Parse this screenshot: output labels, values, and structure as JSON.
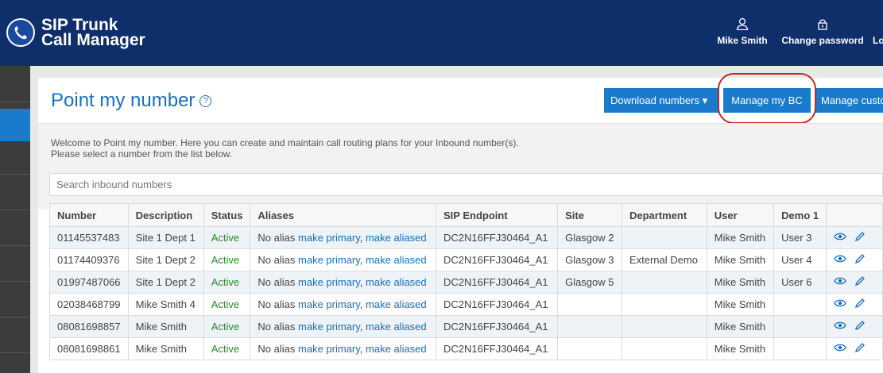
{
  "header": {
    "app_title_line1": "SIP Trunk",
    "app_title_line2": "Call Manager",
    "user_name": "Mike Smith",
    "change_password_label": "Change password",
    "logout_label_partial": "Lo",
    "user_icon": "user-icon",
    "lock_icon": "lock-icon",
    "logo_icon": "phone-icon"
  },
  "page": {
    "title": "Point my number",
    "help_icon": "help-icon",
    "welcome_line1": "Welcome to Point my number. Here you can create and maintain call routing plans for your Inbound number(s).",
    "welcome_line2": "Please select a number from the list below."
  },
  "toolbar": {
    "download_label": "Download numbers ▾",
    "manage_bc_label": "Manage my BC",
    "manage_custom_label": "Manage custo"
  },
  "search": {
    "placeholder": "Search inbound numbers"
  },
  "table": {
    "columns": [
      "Number",
      "Description",
      "Status",
      "Aliases",
      "SIP Endpoint",
      "Site",
      "Department",
      "User",
      "Demo 1",
      ""
    ],
    "rows": [
      {
        "number": "01145537483",
        "description": "Site 1 Dept 1",
        "status": "Active",
        "alias": "No alias",
        "make_primary": "make primary",
        "comma": ",",
        "make_aliased": "make aliased",
        "endpoint": "DC2N16FFJ30464_A1",
        "site": "Glasgow 2",
        "department": "",
        "user": "Mike Smith",
        "demo1": "User 3"
      },
      {
        "number": "01174409376",
        "description": "Site 1 Dept 2",
        "status": "Active",
        "alias": "No alias",
        "make_primary": "make primary",
        "comma": ",",
        "make_aliased": "make aliased",
        "endpoint": "DC2N16FFJ30464_A1",
        "site": "Glasgow 3",
        "department": "External Demo",
        "user": "Mike Smith",
        "demo1": "User 4"
      },
      {
        "number": "01997487066",
        "description": "Site 1 Dept 2",
        "status": "Active",
        "alias": "No alias",
        "make_primary": "make primary",
        "comma": ",",
        "make_aliased": "make aliased",
        "endpoint": "DC2N16FFJ30464_A1",
        "site": "Glasgow 5",
        "department": "",
        "user": "Mike Smith",
        "demo1": "User 6"
      },
      {
        "number": "02038468799",
        "description": "Mike Smith 4",
        "status": "Active",
        "alias": "No alias",
        "make_primary": "make primary",
        "comma": ",",
        "make_aliased": "make aliased",
        "endpoint": "DC2N16FFJ30464_A1",
        "site": "",
        "department": "",
        "user": "Mike Smith",
        "demo1": ""
      },
      {
        "number": "08081698857",
        "description": "Mike Smith",
        "status": "Active",
        "alias": "No alias",
        "make_primary": "make primary",
        "comma": ",",
        "make_aliased": "make aliased",
        "endpoint": "DC2N16FFJ30464_A1",
        "site": "",
        "department": "",
        "user": "Mike Smith",
        "demo1": ""
      },
      {
        "number": "08081698861",
        "description": "Mike Smith",
        "status": "Active",
        "alias": "No alias",
        "make_primary": "make primary",
        "comma": ",",
        "make_aliased": "make aliased",
        "endpoint": "DC2N16FFJ30464_A1",
        "site": "",
        "department": "",
        "user": "Mike Smith",
        "demo1": ""
      }
    ],
    "row_icons": [
      "eye-icon",
      "pencil-icon"
    ]
  },
  "colors": {
    "header_bg": "#0f2f6b",
    "accent_blue": "#1a7acc",
    "link_blue": "#1a6fbf",
    "active_green": "#2a8a2a",
    "highlight_ring": "#c0282a"
  }
}
